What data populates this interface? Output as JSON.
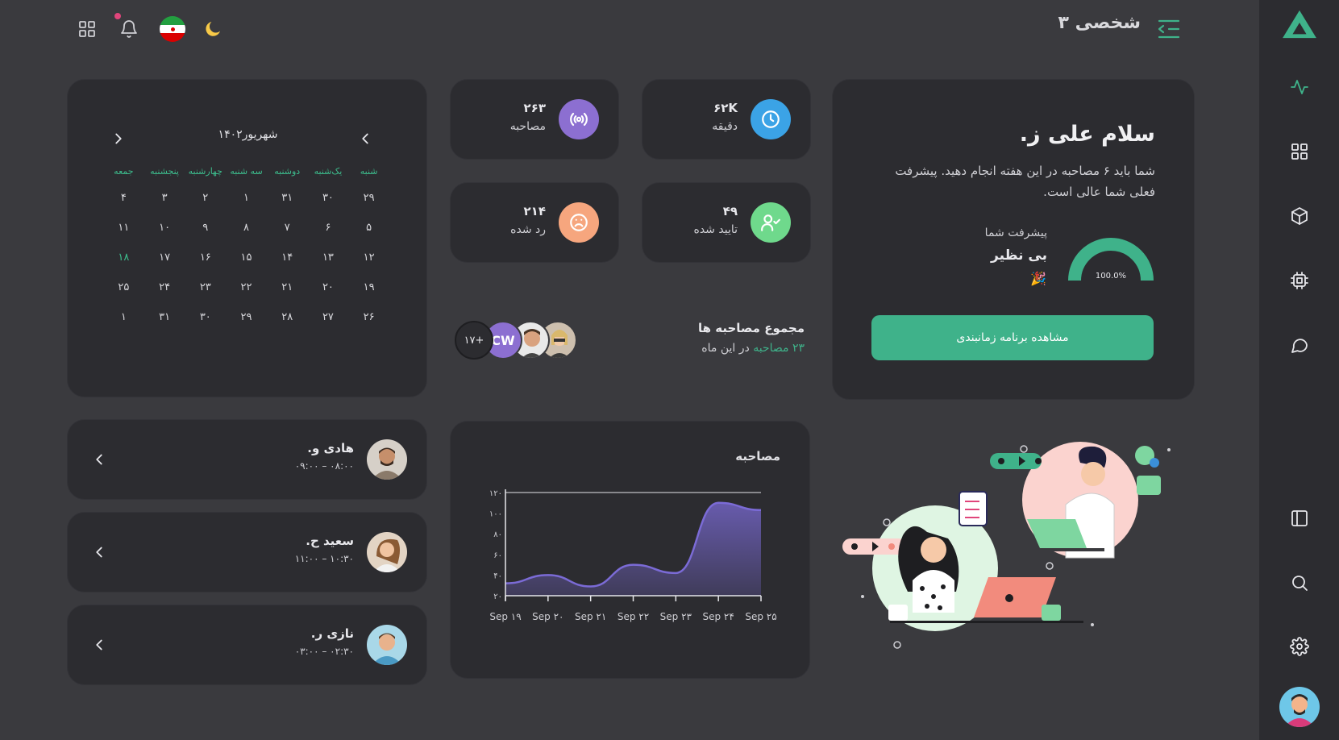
{
  "header": {
    "title": "شخصی ۳"
  },
  "colors": {
    "accent": "#3fb28a",
    "bg": "#3a3a3e",
    "card": "#2c2c30",
    "purple": "#8c6fd1",
    "blue": "#3ba3e6",
    "orange": "#f6a67e",
    "green": "#6fd98c"
  },
  "welcome": {
    "greeting": "سلام علی ز.",
    "message": "شما باید ۶ مصاحبه در این هفته انجام دهید. پیشرفت فعلی شما عالی است.",
    "progress_label": "پیشرفت شما",
    "progress_value": "بی نظیر",
    "gauge_text": "100.0%",
    "gauge_fraction": 1.0,
    "button": "مشاهده برنامه زمانبندی"
  },
  "stats": [
    {
      "value": "۶۲K",
      "label": "دقیقه",
      "icon": "clock-icon",
      "color": "#3ba3e6"
    },
    {
      "value": "۲۶۳",
      "label": "مصاحبه",
      "icon": "broadcast-icon",
      "color": "#8c6fd1"
    },
    {
      "value": "۴۹",
      "label": "تایید شده",
      "icon": "user-check-icon",
      "color": "#6fd98c"
    },
    {
      "value": "۲۱۴",
      "label": "رد شده",
      "icon": "sad-face-icon",
      "color": "#f6a67e"
    }
  ],
  "total": {
    "title": "مجموع مصاحبه ها",
    "count_text": "۲۳ مصاحبه",
    "suffix": "در این ماه",
    "more": "۱۷+",
    "initials": "CW"
  },
  "calendar": {
    "month": "شهریور۱۴۰۲",
    "weekdays": [
      "شنبه",
      "یک‌شنبه",
      "دوشنبه",
      "سه شنبه",
      "چهارشنبه",
      "پنجشنبه",
      "جمعه"
    ],
    "weeks": [
      [
        "۲۹",
        "۳۰",
        "۳۱",
        "۱",
        "۲",
        "۳",
        "۴"
      ],
      [
        "۵",
        "۶",
        "۷",
        "۸",
        "۹",
        "۱۰",
        "۱۱"
      ],
      [
        "۱۲",
        "۱۳",
        "۱۴",
        "۱۵",
        "۱۶",
        "۱۷",
        "۱۸"
      ],
      [
        "۱۹",
        "۲۰",
        "۲۱",
        "۲۲",
        "۲۳",
        "۲۴",
        "۲۵"
      ],
      [
        "۲۶",
        "۲۷",
        "۲۸",
        "۲۹",
        "۳۰",
        "۳۱",
        "۱"
      ]
    ],
    "today": "۱۸"
  },
  "people": [
    {
      "name": "هادی و.",
      "time": "۰۸:۰۰ – ۰۹:۰۰"
    },
    {
      "name": "سعید ح.",
      "time": "۱۰:۳۰ – ۱۱:۰۰"
    },
    {
      "name": "نازی ر.",
      "time": "۰۲:۳۰ – ۰۳:۰۰"
    }
  ],
  "chart_data": {
    "type": "area",
    "title": "مصاحبه",
    "x": [
      "Sep ۱۹",
      "Sep ۲۰",
      "Sep ۲۱",
      "Sep ۲۲",
      "Sep ۲۳",
      "Sep ۲۴",
      "Sep ۲۵"
    ],
    "series": [
      {
        "values": [
          32,
          40,
          29,
          50,
          42,
          110,
          103
        ]
      }
    ],
    "ylim": [
      20,
      120
    ],
    "yticks": [
      "۲۰",
      "۴۰",
      "۶۰",
      "۸۰",
      "۱۰۰",
      "۱۲۰"
    ],
    "color": "#7b6bd6"
  }
}
